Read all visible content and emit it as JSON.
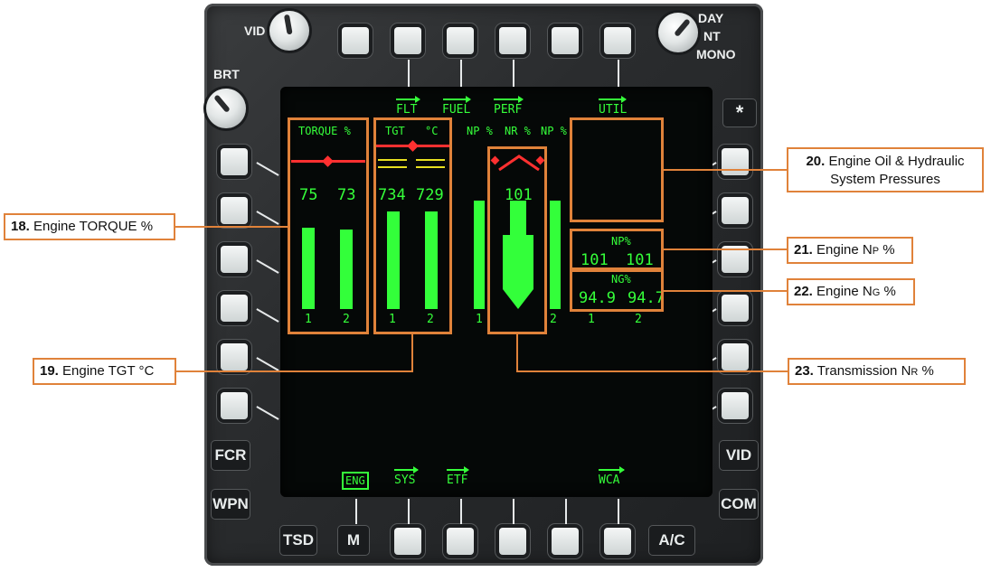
{
  "bezel": {
    "knobs": {
      "vid": "VID",
      "brt": "BRT",
      "day": "DAY",
      "nt": "NT",
      "mono": "MONO"
    },
    "left_buttons": {
      "fcr": "FCR",
      "wpn": "WPN",
      "tsd": "TSD",
      "m": "M"
    },
    "right_buttons": {
      "star": "*",
      "vid": "VID",
      "com": "COM",
      "ac": "A/C"
    }
  },
  "screen": {
    "top_menu": [
      "FLT",
      "FUEL",
      "PERF",
      "UTIL"
    ],
    "bottom_menu": [
      "ENG",
      "SYS",
      "ETF",
      "WCA"
    ],
    "torque": {
      "header": "TORQUE %",
      "values": [
        "75",
        "73"
      ],
      "engines": [
        "1",
        "2"
      ],
      "levels": [
        0.75,
        0.73
      ]
    },
    "tgt": {
      "header_left": "TGT",
      "header_right": "°C",
      "values": [
        "734",
        "729"
      ],
      "engines": [
        "1",
        "2"
      ],
      "levels": [
        0.85,
        0.85
      ]
    },
    "rotor": {
      "np_left": "NP %",
      "nr": "NR %",
      "np_right": "NP %",
      "nr_value": "101",
      "engines": [
        "1",
        "2"
      ]
    },
    "np": {
      "label": "NP%",
      "values": [
        "101",
        "101"
      ]
    },
    "ng": {
      "label": "NG%",
      "values": [
        "94.9",
        "94.7"
      ],
      "engines": [
        "1",
        "2"
      ]
    }
  },
  "callouts": {
    "c18": {
      "num": "18.",
      "text": "Engine TORQUE %"
    },
    "c19": {
      "num": "19.",
      "text": "Engine TGT °C"
    },
    "c20": {
      "num": "20.",
      "line1": "Engine Oil & Hydraulic",
      "line2": "System Pressures"
    },
    "c21": {
      "num": "21.",
      "text_a": "Engine N",
      "sub": "P",
      "text_b": " %"
    },
    "c22": {
      "num": "22.",
      "text_a": "Engine N",
      "sub": "G",
      "text_b": " %"
    },
    "c23": {
      "num": "23.",
      "text_a": "Transmission N",
      "sub": "R",
      "text_b": " %"
    }
  },
  "colors": {
    "display_green": "#35ff3a",
    "callout_orange": "#e0823a",
    "caution_red": "#ff3030",
    "caution_yellow": "#e8e020"
  }
}
